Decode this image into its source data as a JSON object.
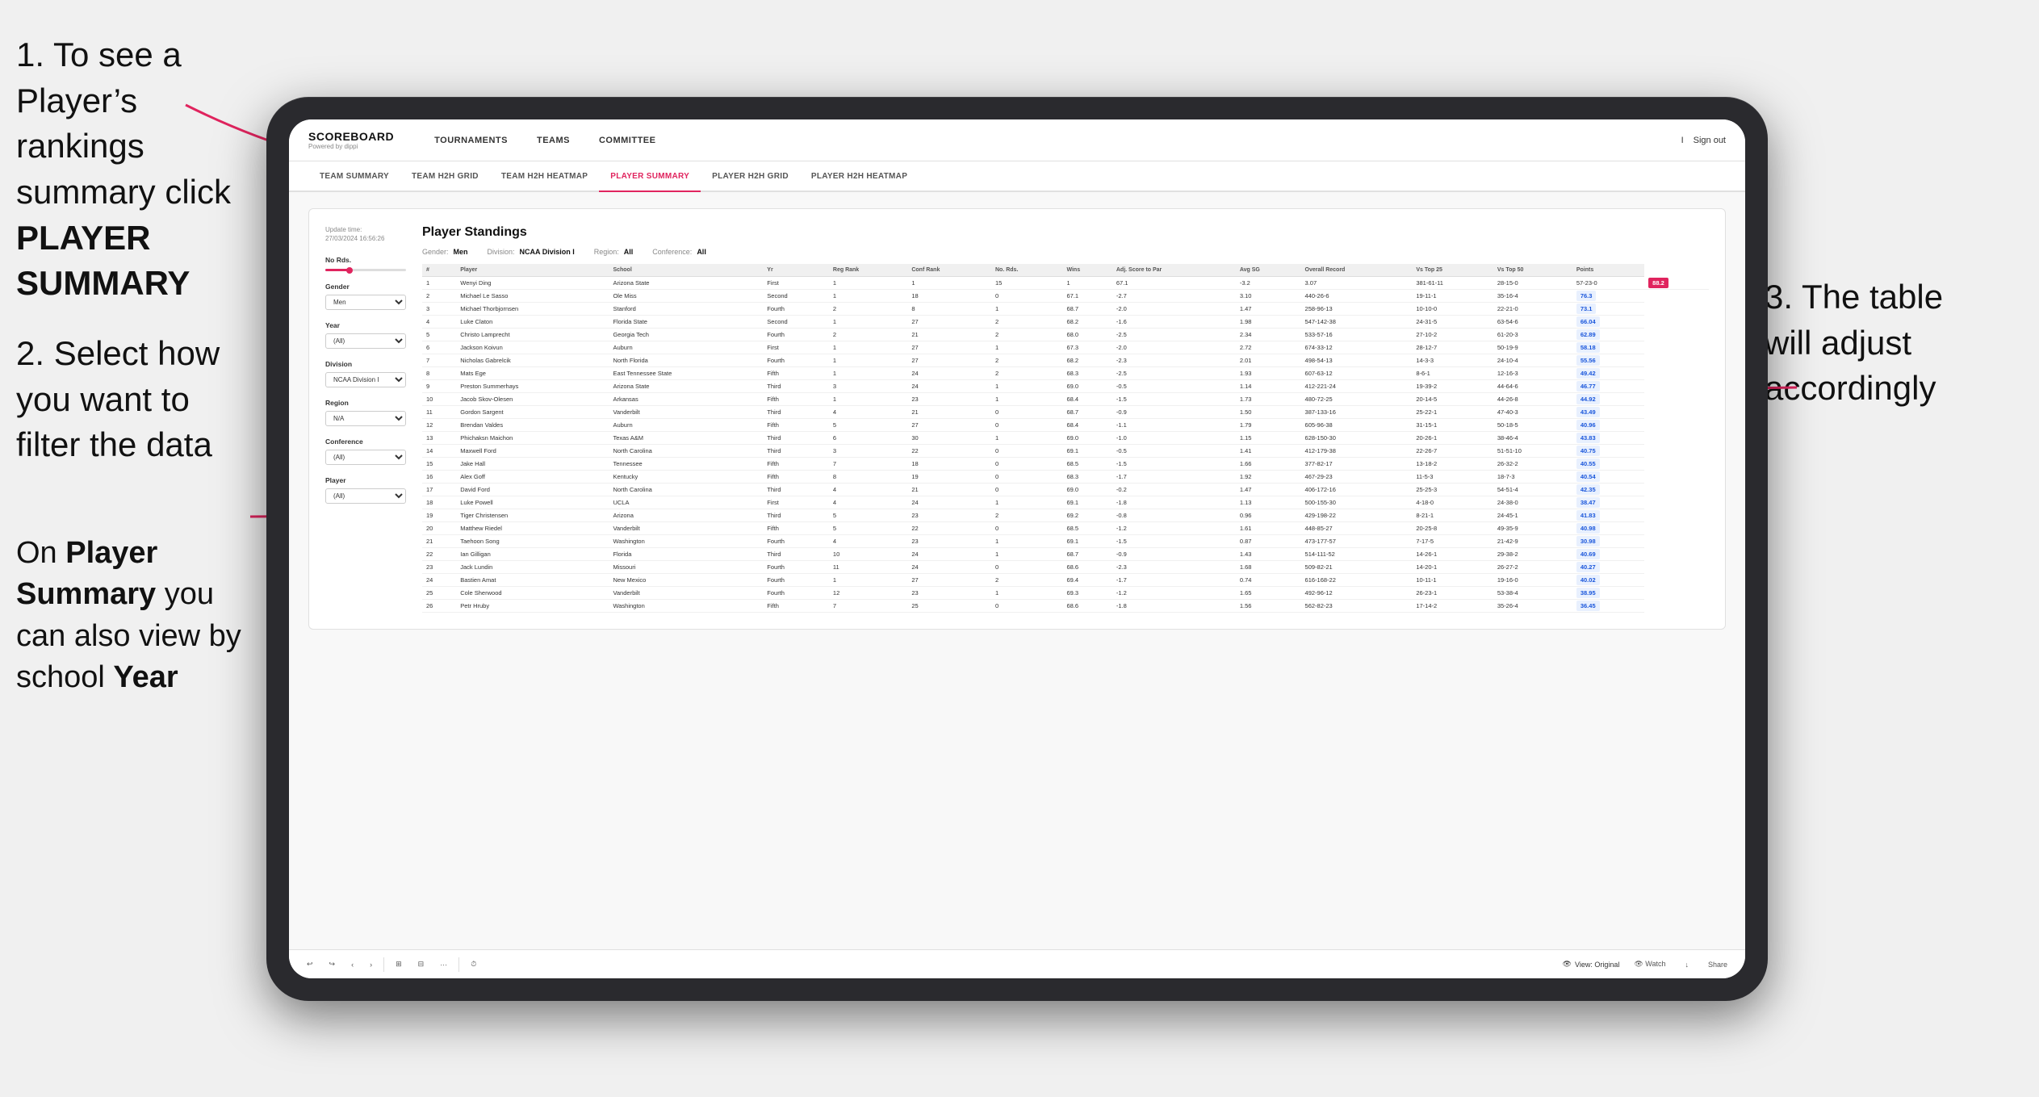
{
  "instructions": {
    "step1": "1. To see a Player’s rankings summary click ",
    "step1_bold": "PLAYER SUMMARY",
    "step2_intro": "2. Select how you want to filter the data",
    "step2_note_intro": "On ",
    "step2_note_bold1": "Player Summary",
    "step2_note_mid": " you can also view by school ",
    "step2_note_bold2": "Year",
    "step3": "3. The table will adjust accordingly"
  },
  "app": {
    "logo": "SCOREBOARD",
    "logo_sub": "Powered by dippi",
    "sign_out": "Sign out",
    "nav_separator": "I"
  },
  "nav": {
    "items": [
      "TOURNAMENTS",
      "TEAMS",
      "COMMITTEE"
    ]
  },
  "sub_nav": {
    "items": [
      "TEAM SUMMARY",
      "TEAM H2H GRID",
      "TEAM H2H HEATMAP",
      "PLAYER SUMMARY",
      "PLAYER H2H GRID",
      "PLAYER H2H HEATMAP"
    ],
    "active": "PLAYER SUMMARY"
  },
  "filters": {
    "update_time_label": "Update time:",
    "update_time_value": "27/03/2024 16:56:26",
    "no_rds_label": "No Rds.",
    "gender_label": "Gender",
    "gender_value": "Men",
    "year_label": "Year",
    "year_value": "(All)",
    "division_label": "Division",
    "division_value": "NCAA Division I",
    "region_label": "Region",
    "region_value": "N/A",
    "conference_label": "Conference",
    "conference_value": "(All)",
    "player_label": "Player",
    "player_value": "(All)"
  },
  "table": {
    "title": "Player Standings",
    "gender_label": "Gender:",
    "gender_value": "Men",
    "division_label": "Division:",
    "division_value": "NCAA Division I",
    "region_label": "Region:",
    "region_value": "All",
    "conference_label": "Conference:",
    "conference_value": "All",
    "columns": [
      "#",
      "Player",
      "School",
      "Yr",
      "Reg Rank",
      "Conf Rank",
      "No. Rds.",
      "Wins",
      "Adj. Score to Par",
      "Avg SG",
      "Overall Record",
      "Vs Top 25",
      "Vs Top 50",
      "Points"
    ],
    "rows": [
      [
        "1",
        "Wenyi Ding",
        "Arizona State",
        "First",
        "1",
        "1",
        "15",
        "1",
        "67.1",
        "-3.2",
        "3.07",
        "381-61-11",
        "28-15-0",
        "57-23-0",
        "88.2"
      ],
      [
        "2",
        "Michael Le Sasso",
        "Ole Miss",
        "Second",
        "1",
        "18",
        "0",
        "67.1",
        "-2.7",
        "3.10",
        "440-26-6",
        "19-11-1",
        "35-16-4",
        "76.3"
      ],
      [
        "3",
        "Michael Thorbjornsen",
        "Stanford",
        "Fourth",
        "2",
        "8",
        "1",
        "68.7",
        "-2.0",
        "1.47",
        "258-96-13",
        "10-10-0",
        "22-21-0",
        "73.1"
      ],
      [
        "4",
        "Luke Claton",
        "Florida State",
        "Second",
        "1",
        "27",
        "2",
        "68.2",
        "-1.6",
        "1.98",
        "547-142-38",
        "24-31-5",
        "63-54-6",
        "66.04"
      ],
      [
        "5",
        "Christo Lamprecht",
        "Georgia Tech",
        "Fourth",
        "2",
        "21",
        "2",
        "68.0",
        "-2.5",
        "2.34",
        "533-57-16",
        "27-10-2",
        "61-20-3",
        "62.89"
      ],
      [
        "6",
        "Jackson Koivun",
        "Auburn",
        "First",
        "1",
        "27",
        "1",
        "67.3",
        "-2.0",
        "2.72",
        "674-33-12",
        "28-12-7",
        "50-19-9",
        "58.18"
      ],
      [
        "7",
        "Nicholas Gabrelcik",
        "North Florida",
        "Fourth",
        "1",
        "27",
        "2",
        "68.2",
        "-2.3",
        "2.01",
        "498-54-13",
        "14-3-3",
        "24-10-4",
        "55.56"
      ],
      [
        "8",
        "Mats Ege",
        "East Tennessee State",
        "Fifth",
        "1",
        "24",
        "2",
        "68.3",
        "-2.5",
        "1.93",
        "607-63-12",
        "8-6-1",
        "12-16-3",
        "49.42"
      ],
      [
        "9",
        "Preston Summerhays",
        "Arizona State",
        "Third",
        "3",
        "24",
        "1",
        "69.0",
        "-0.5",
        "1.14",
        "412-221-24",
        "19-39-2",
        "44-64-6",
        "46.77"
      ],
      [
        "10",
        "Jacob Skov-Olesen",
        "Arkansas",
        "Fifth",
        "1",
        "23",
        "1",
        "68.4",
        "-1.5",
        "1.73",
        "480-72-25",
        "20-14-5",
        "44-26-8",
        "44.92"
      ],
      [
        "11",
        "Gordon Sargent",
        "Vanderbilt",
        "Third",
        "4",
        "21",
        "0",
        "68.7",
        "-0.9",
        "1.50",
        "387-133-16",
        "25-22-1",
        "47-40-3",
        "43.49"
      ],
      [
        "12",
        "Brendan Valdes",
        "Auburn",
        "Fifth",
        "5",
        "27",
        "0",
        "68.4",
        "-1.1",
        "1.79",
        "605-96-38",
        "31-15-1",
        "50-18-5",
        "40.96"
      ],
      [
        "13",
        "Phichaksn Maichon",
        "Texas A&M",
        "Third",
        "6",
        "30",
        "1",
        "69.0",
        "-1.0",
        "1.15",
        "628-150-30",
        "20-26-1",
        "38-46-4",
        "43.83"
      ],
      [
        "14",
        "Maxwell Ford",
        "North Carolina",
        "Third",
        "3",
        "22",
        "0",
        "69.1",
        "-0.5",
        "1.41",
        "412-179-38",
        "22-26-7",
        "51-51-10",
        "40.75"
      ],
      [
        "15",
        "Jake Hall",
        "Tennessee",
        "Fifth",
        "7",
        "18",
        "0",
        "68.5",
        "-1.5",
        "1.66",
        "377-82-17",
        "13-18-2",
        "26-32-2",
        "40.55"
      ],
      [
        "16",
        "Alex Goff",
        "Kentucky",
        "Fifth",
        "8",
        "19",
        "0",
        "68.3",
        "-1.7",
        "1.92",
        "467-29-23",
        "11-5-3",
        "18-7-3",
        "40.54"
      ],
      [
        "17",
        "David Ford",
        "North Carolina",
        "Third",
        "4",
        "21",
        "0",
        "69.0",
        "-0.2",
        "1.47",
        "406-172-16",
        "25-25-3",
        "54-51-4",
        "42.35"
      ],
      [
        "18",
        "Luke Powell",
        "UCLA",
        "First",
        "4",
        "24",
        "1",
        "69.1",
        "-1.8",
        "1.13",
        "500-155-30",
        "4-18-0",
        "24-38-0",
        "38.47"
      ],
      [
        "19",
        "Tiger Christensen",
        "Arizona",
        "Third",
        "5",
        "23",
        "2",
        "69.2",
        "-0.8",
        "0.96",
        "429-198-22",
        "8-21-1",
        "24-45-1",
        "41.83"
      ],
      [
        "20",
        "Matthew Riedel",
        "Vanderbilt",
        "Fifth",
        "5",
        "22",
        "0",
        "68.5",
        "-1.2",
        "1.61",
        "448-85-27",
        "20-25-8",
        "49-35-9",
        "40.98"
      ],
      [
        "21",
        "Taehoon Song",
        "Washington",
        "Fourth",
        "4",
        "23",
        "1",
        "69.1",
        "-1.5",
        "0.87",
        "473-177-57",
        "7-17-5",
        "21-42-9",
        "30.98"
      ],
      [
        "22",
        "Ian Gilligan",
        "Florida",
        "Third",
        "10",
        "24",
        "1",
        "68.7",
        "-0.9",
        "1.43",
        "514-111-52",
        "14-26-1",
        "29-38-2",
        "40.69"
      ],
      [
        "23",
        "Jack Lundin",
        "Missouri",
        "Fourth",
        "11",
        "24",
        "0",
        "68.6",
        "-2.3",
        "1.68",
        "509-82-21",
        "14-20-1",
        "26-27-2",
        "40.27"
      ],
      [
        "24",
        "Bastien Amat",
        "New Mexico",
        "Fourth",
        "1",
        "27",
        "2",
        "69.4",
        "-1.7",
        "0.74",
        "616-168-22",
        "10-11-1",
        "19-16-0",
        "40.02"
      ],
      [
        "25",
        "Cole Sherwood",
        "Vanderbilt",
        "Fourth",
        "12",
        "23",
        "1",
        "69.3",
        "-1.2",
        "1.65",
        "492-96-12",
        "26-23-1",
        "53-38-4",
        "38.95"
      ],
      [
        "26",
        "Petr Hruby",
        "Washington",
        "Fifth",
        "7",
        "25",
        "0",
        "68.6",
        "-1.8",
        "1.56",
        "562-82-23",
        "17-14-2",
        "35-26-4",
        "36.45"
      ]
    ]
  },
  "toolbar": {
    "undo": "↩",
    "redo": "↪",
    "back": "‹",
    "forward": "›",
    "copy": "⊞",
    "paste": "⊟",
    "separator": "|",
    "clock": "⏱",
    "view_label": "View: Original",
    "watch_label": "Watch",
    "download_label": "↓",
    "share_label": "Share"
  }
}
